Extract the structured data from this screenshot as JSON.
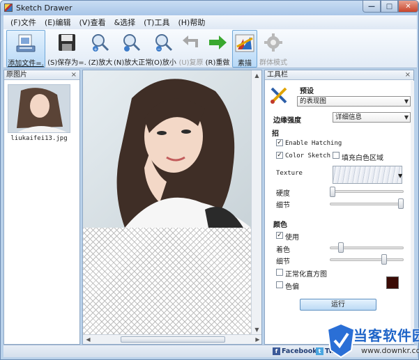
{
  "window": {
    "title": "Sketch Drawer",
    "controls": {
      "minimize": "—",
      "maximize": "□",
      "close": "✕"
    }
  },
  "menu": [
    "(F)文件",
    "(E)编辑",
    "(V)查看",
    "&选择",
    "(T)工具",
    "(H)帮助"
  ],
  "toolbar": [
    {
      "label": "添加文件=.",
      "icon": "add-file-icon",
      "state": "active"
    },
    {
      "label": "(S)保存为=.",
      "icon": "save-icon",
      "state": "normal"
    },
    {
      "label": "(Z)放大",
      "icon": "zoom-in-icon",
      "state": "normal"
    },
    {
      "label": "(N)放大正常",
      "icon": "zoom-normal-icon",
      "state": "normal"
    },
    {
      "label": "(O)放小",
      "icon": "zoom-out-icon",
      "state": "normal"
    },
    {
      "label": "(U)复原",
      "icon": "undo-icon",
      "state": "disabled"
    },
    {
      "label": "(R)重做",
      "icon": "redo-icon",
      "state": "normal"
    },
    {
      "label": "素描",
      "icon": "sketch-icon",
      "state": "active"
    },
    {
      "label": "群体模式",
      "icon": "gear-icon",
      "state": "disabled"
    }
  ],
  "left_panel": {
    "title": "原图片",
    "close": "×",
    "thumbnail_name": "liukaifei13.jpg"
  },
  "right_panel": {
    "title": "工具栏",
    "close": "×",
    "preset_label": "预设",
    "preset_value": "的表现图",
    "edge_label": "边缘强度",
    "edge_value": "详细信息",
    "section_stroke": "招",
    "enable_hatching": {
      "label": "Enable Hatching",
      "checked": true
    },
    "color_sketch": {
      "label": "Color Sketch",
      "checked": true
    },
    "fill_white": {
      "label": "填充白色区域",
      "checked": false
    },
    "texture_label": "Texture",
    "hardness_label": "硬度",
    "hardness_value": 0.0,
    "detail_label": "细节",
    "detail_value": 1.0,
    "section_color": "颜色",
    "use_color": {
      "label": "使用",
      "checked": true
    },
    "tint_label": "着色",
    "tint_value": 0.12,
    "color_detail_label": "细节",
    "color_detail_value": 0.75,
    "normalize_hist": {
      "label": "正常化直方图",
      "checked": false
    },
    "color_cast": {
      "label": "色偏",
      "checked": false
    },
    "color_swatch": "#3a0b05",
    "run_button": "运行"
  },
  "status": {
    "facebook": "Facebook",
    "twitter": "Tw"
  },
  "watermark": {
    "title": "当客软件园",
    "url": "www.downkr.com"
  },
  "colors": {
    "window_bg": "#b9d1ea",
    "accent": "#1e64c8"
  }
}
